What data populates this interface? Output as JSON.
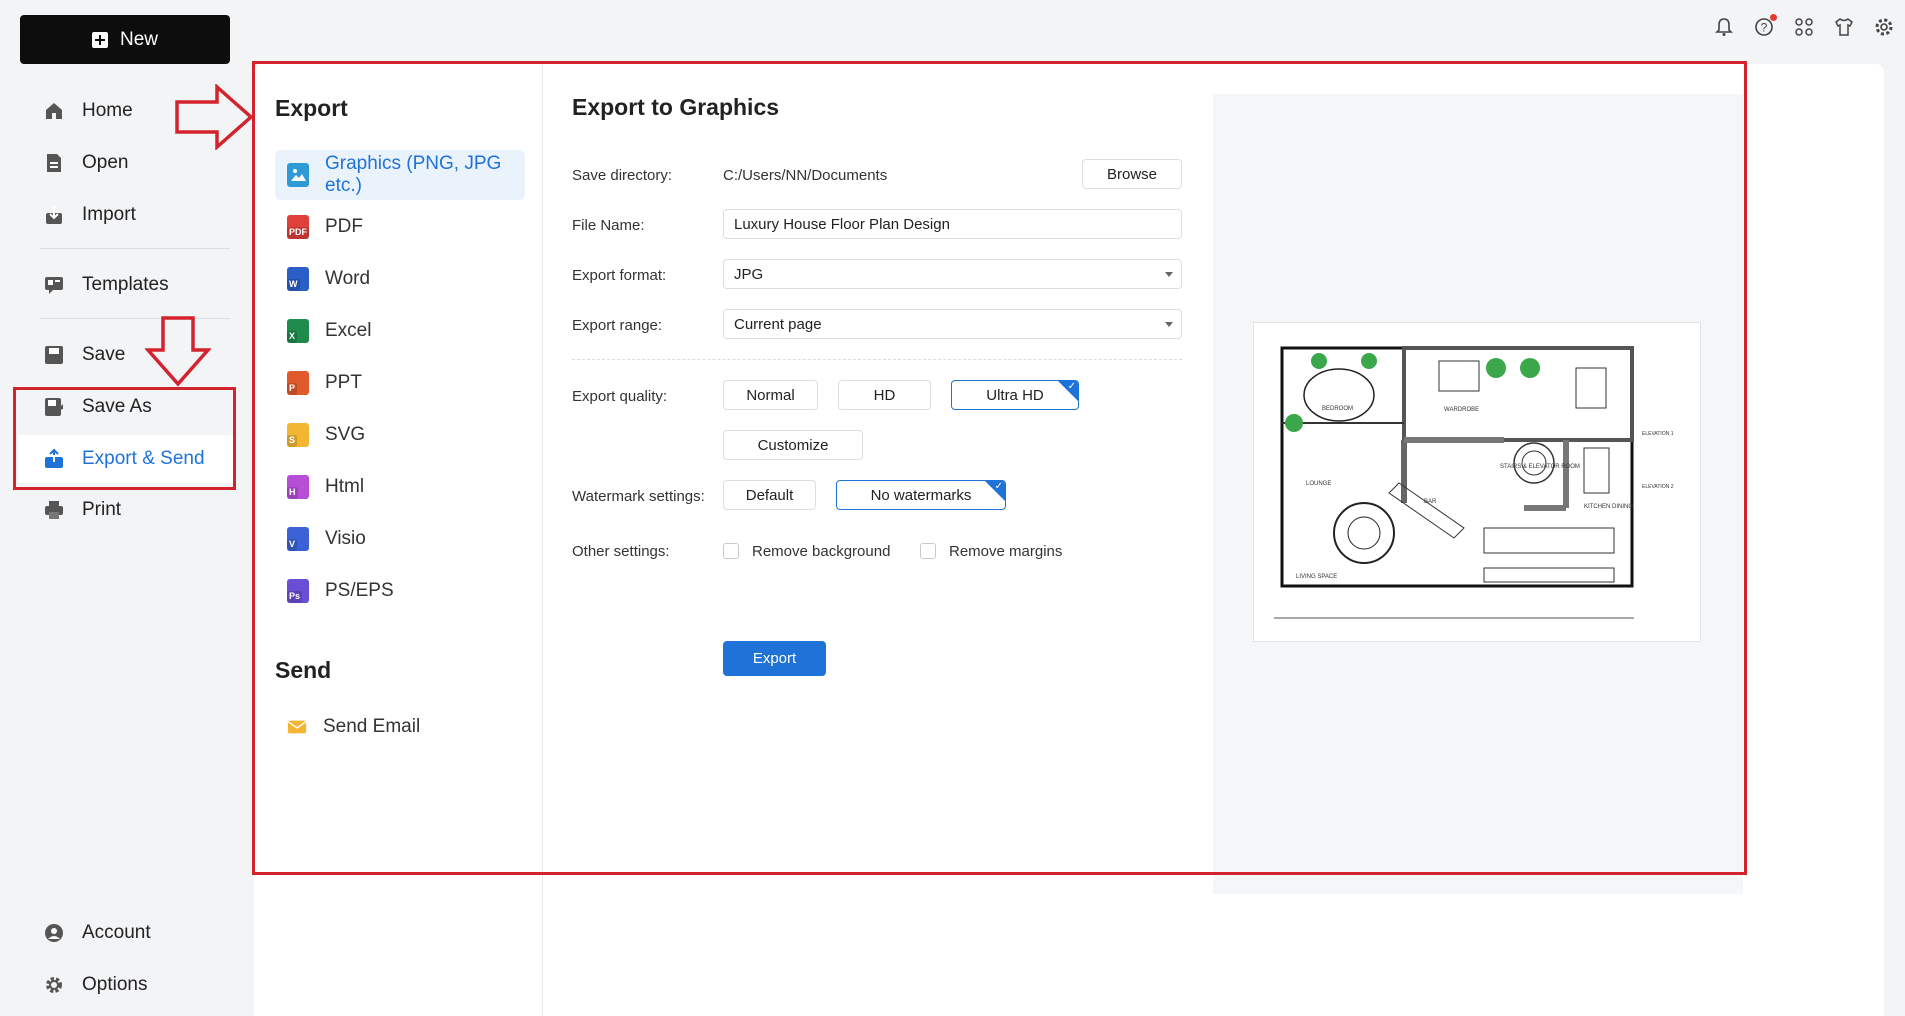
{
  "sidebar": {
    "new_label": "New",
    "items": [
      {
        "label": "Home",
        "icon": "home-icon"
      },
      {
        "label": "Open",
        "icon": "open-file-icon"
      },
      {
        "label": "Import",
        "icon": "import-icon"
      },
      {
        "label": "Templates",
        "icon": "templates-icon"
      },
      {
        "label": "Save",
        "icon": "save-icon"
      },
      {
        "label": "Save As",
        "icon": "save-as-icon"
      },
      {
        "label": "Export & Send",
        "icon": "export-icon"
      },
      {
        "label": "Print",
        "icon": "print-icon"
      }
    ],
    "bottom": [
      {
        "label": "Account",
        "icon": "account-icon"
      },
      {
        "label": "Options",
        "icon": "gear-icon"
      }
    ]
  },
  "top_icons": [
    "bell-icon",
    "help-icon",
    "apps-icon",
    "shirt-icon",
    "settings-icon"
  ],
  "export_panel": {
    "export_title": "Export",
    "items": [
      {
        "label": "Graphics (PNG, JPG etc.)",
        "icon": "image-file-icon",
        "color": "#2f9bd6",
        "tag": ""
      },
      {
        "label": "PDF",
        "icon": "pdf-file-icon",
        "color": "#e0403a",
        "tag": "PDF"
      },
      {
        "label": "Word",
        "icon": "word-file-icon",
        "color": "#2b5fc7",
        "tag": "W"
      },
      {
        "label": "Excel",
        "icon": "excel-file-icon",
        "color": "#1e8a4c",
        "tag": "X"
      },
      {
        "label": "PPT",
        "icon": "ppt-file-icon",
        "color": "#e05a2b",
        "tag": "P"
      },
      {
        "label": "SVG",
        "icon": "svg-file-icon",
        "color": "#f2b632",
        "tag": "S"
      },
      {
        "label": "Html",
        "icon": "html-file-icon",
        "color": "#b74fd6",
        "tag": "H"
      },
      {
        "label": "Visio",
        "icon": "visio-file-icon",
        "color": "#3a62d6",
        "tag": "V"
      },
      {
        "label": "PS/EPS",
        "icon": "ps-file-icon",
        "color": "#6a4fd6",
        "tag": "Ps"
      }
    ],
    "send_title": "Send",
    "send_items": [
      {
        "label": "Send Email",
        "icon": "email-icon"
      }
    ]
  },
  "form": {
    "title": "Export to Graphics",
    "save_directory_label": "Save directory:",
    "save_directory_value": "C:/Users/NN/Documents",
    "browse_label": "Browse",
    "file_name_label": "File Name:",
    "file_name_value": "Luxury House Floor Plan Design",
    "export_format_label": "Export format:",
    "export_format_value": "JPG",
    "export_range_label": "Export range:",
    "export_range_value": "Current page",
    "export_quality_label": "Export quality:",
    "quality_options": [
      "Normal",
      "HD",
      "Ultra HD"
    ],
    "quality_selected": "Ultra HD",
    "customize_label": "Customize",
    "watermark_label": "Watermark settings:",
    "watermark_options": [
      "Default",
      "No watermarks"
    ],
    "watermark_selected": "No watermarks",
    "other_settings_label": "Other settings:",
    "remove_background_label": "Remove background",
    "remove_margins_label": "Remove margins",
    "export_button_label": "Export"
  },
  "preview": {
    "room_labels": [
      "BEDROOM",
      "WARDROBE",
      "LOUNGE",
      "STAIRS & ELEVATOR ROOM",
      "BAR",
      "KITCHEN DINING",
      "LIVING SPACE",
      "ELEVATION 1",
      "ELEVATION 2"
    ]
  },
  "annotation_color": "#d3232f"
}
